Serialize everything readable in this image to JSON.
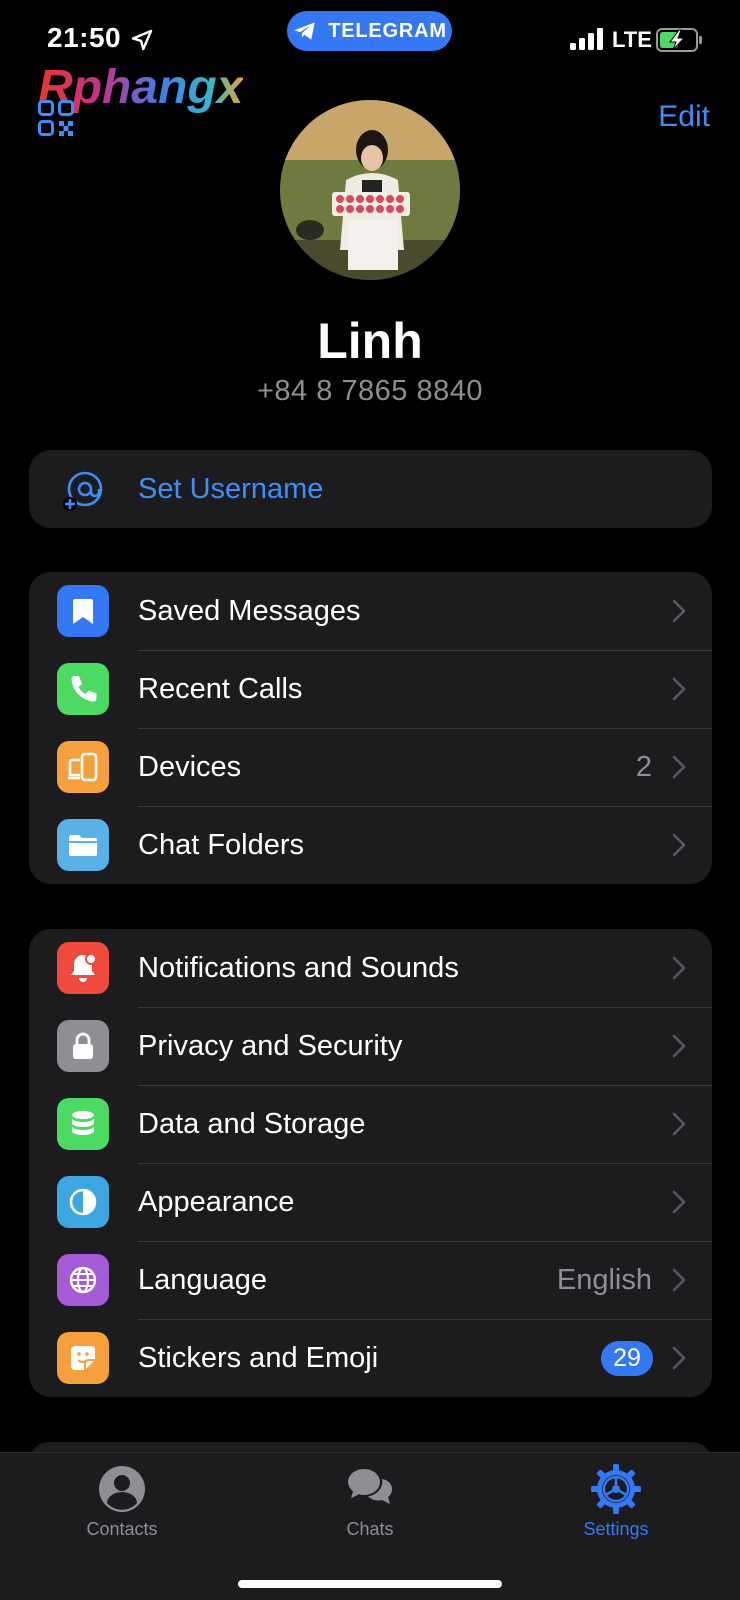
{
  "status_bar": {
    "time": "21:50",
    "app_pill": "TELEGRAM",
    "network": "LTE"
  },
  "watermark": {
    "text": "Rphangx"
  },
  "header": {
    "edit_label": "Edit"
  },
  "profile": {
    "name": "Linh",
    "phone": "+84 8 7865 8840"
  },
  "username": {
    "label": "Set Username"
  },
  "group1": [
    {
      "label": "Saved Messages",
      "icon": "bookmark-icon",
      "color": "#3478f6"
    },
    {
      "label": "Recent Calls",
      "icon": "phone-icon",
      "color": "#4cd964"
    },
    {
      "label": "Devices",
      "icon": "devices-icon",
      "color": "#f7a13e",
      "value": "2"
    },
    {
      "label": "Chat Folders",
      "icon": "folder-icon",
      "color": "#5ab1e8"
    }
  ],
  "group2": [
    {
      "label": "Notifications and Sounds",
      "icon": "bell-icon",
      "color": "#f04a3e"
    },
    {
      "label": "Privacy and Security",
      "icon": "lock-icon",
      "color": "#8e8e93"
    },
    {
      "label": "Data and Storage",
      "icon": "database-icon",
      "color": "#4cd964"
    },
    {
      "label": "Appearance",
      "icon": "half-circle-icon",
      "color": "#3ea6e0"
    },
    {
      "label": "Language",
      "icon": "globe-icon",
      "color": "#a55bd6",
      "value": "English"
    },
    {
      "label": "Stickers and Emoji",
      "icon": "sticker-icon",
      "color": "#f7a13e",
      "badge": "29"
    }
  ],
  "tabs": [
    {
      "label": "Contacts",
      "icon": "person-icon",
      "active": false
    },
    {
      "label": "Chats",
      "icon": "chat-bubbles-icon",
      "active": false
    },
    {
      "label": "Settings",
      "icon": "gear-icon",
      "active": true
    }
  ],
  "colors": {
    "accent": "#3478f6",
    "link": "#3e8ef7",
    "background": "#000000",
    "cell": "#1c1c1e",
    "secondary_text": "#8e8e93"
  }
}
